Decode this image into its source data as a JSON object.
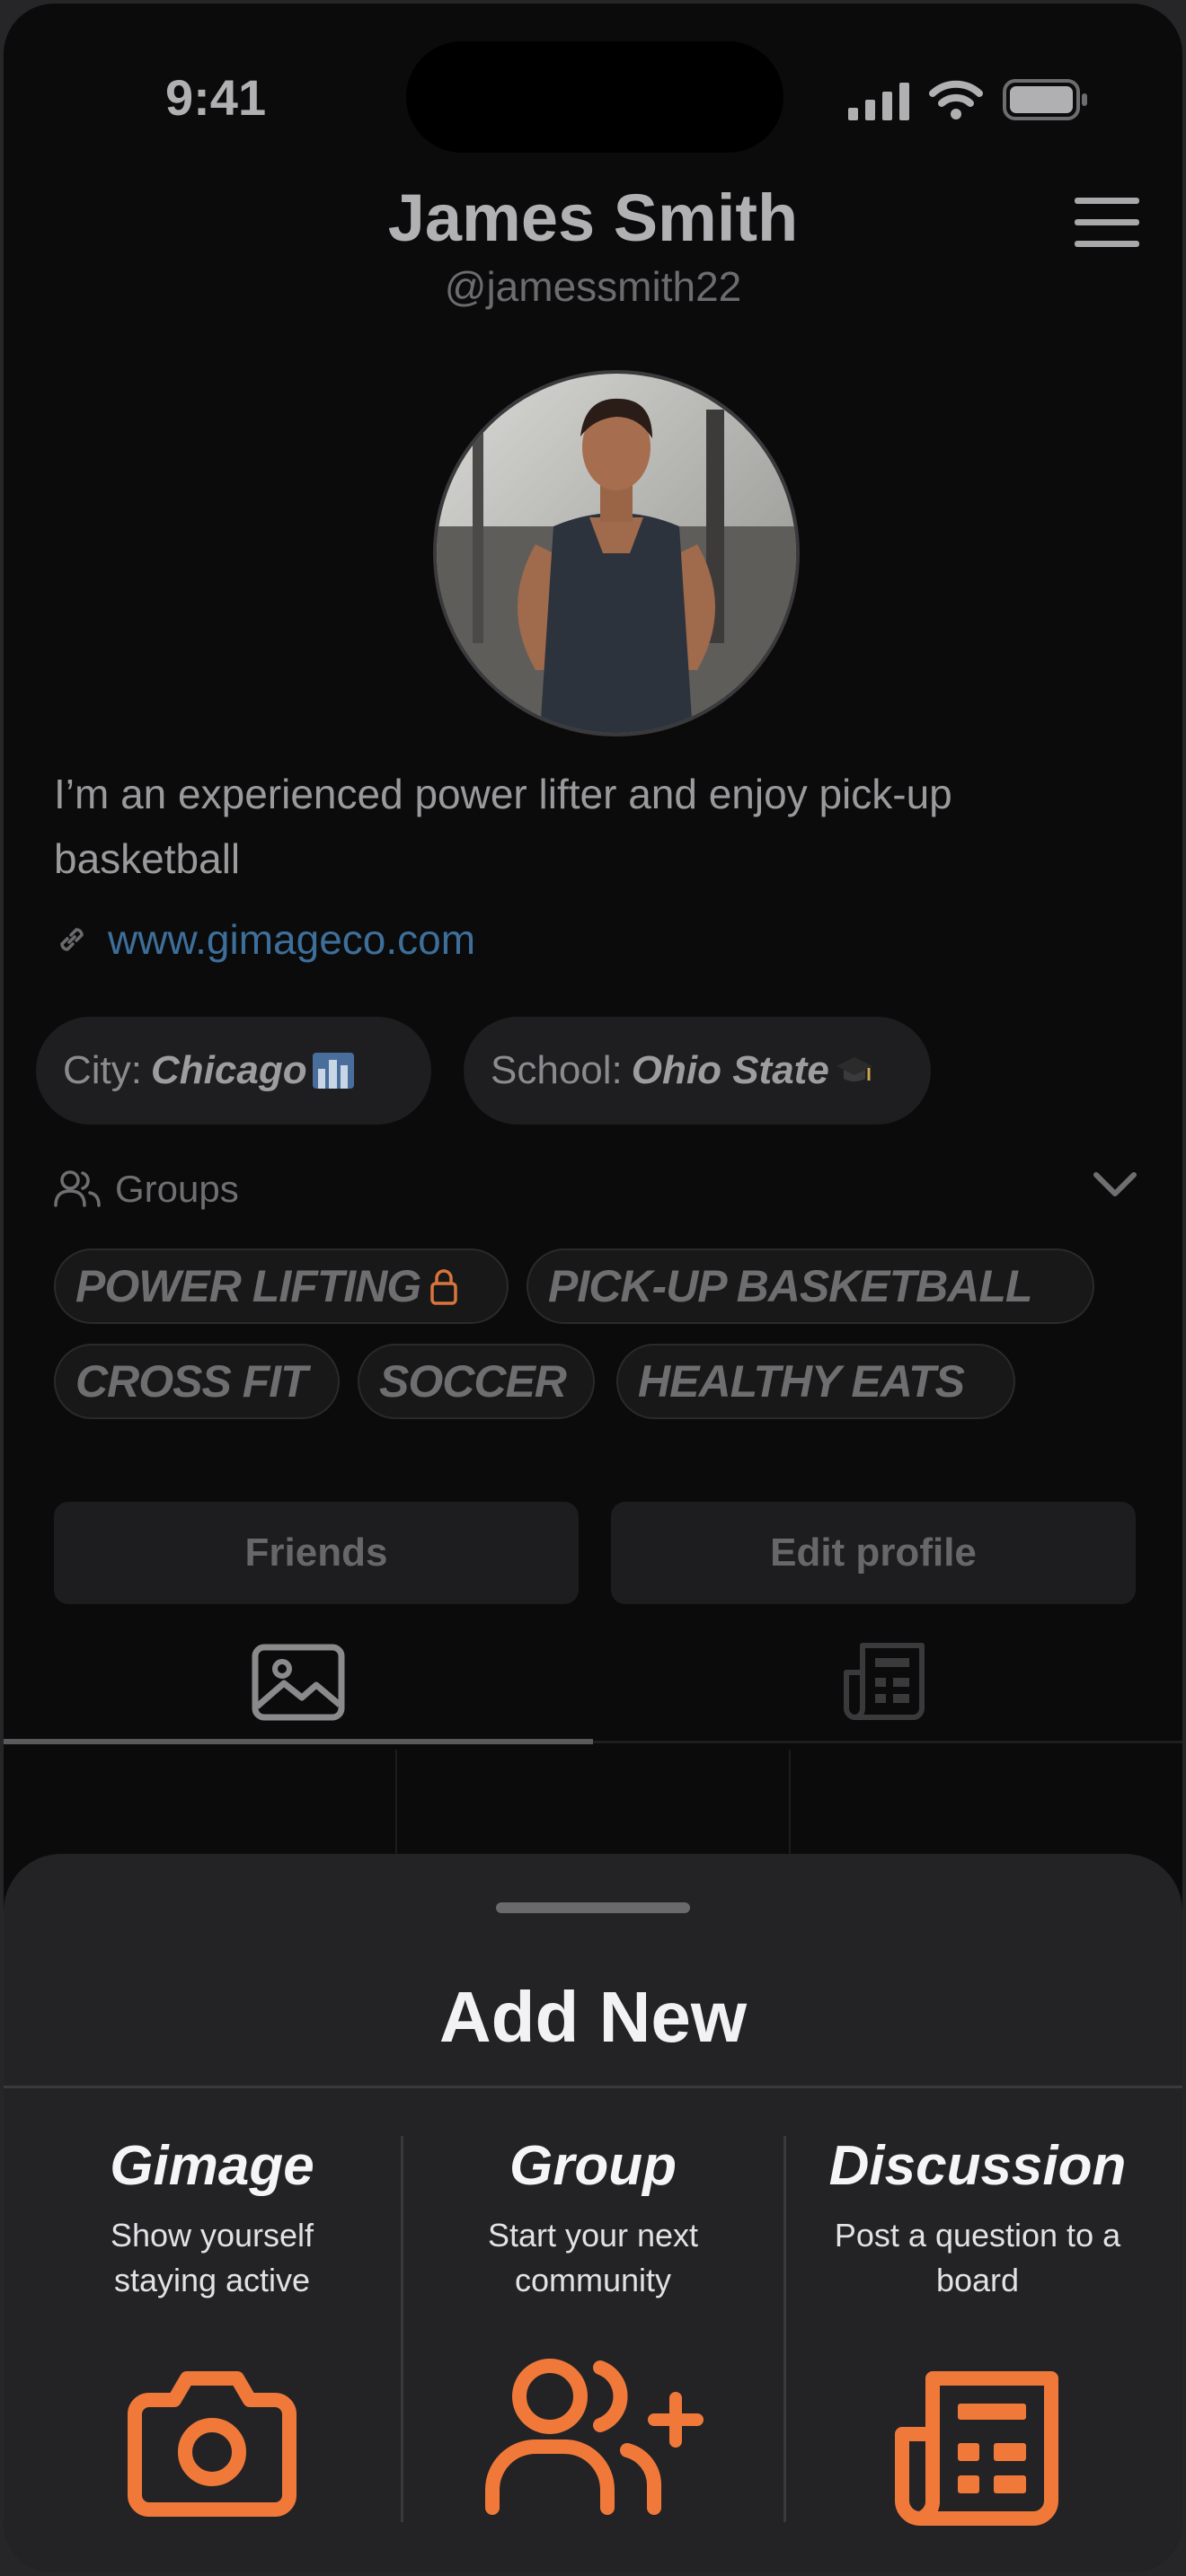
{
  "status_bar": {
    "time": "9:41"
  },
  "profile": {
    "name": "James Smith",
    "handle": "@jamessmith22",
    "bio": "I’m an experienced power lifter and enjoy pick-up basketball",
    "website": "www.gimageco.com",
    "city_label": "City:",
    "city_value": "Chicago",
    "school_label": "School:",
    "school_value": "Ohio State"
  },
  "groups": {
    "label": "Groups",
    "tags": [
      "POWER LIFTING",
      "PICK-UP BASKETBALL",
      "CROSS FIT",
      "SOCCER",
      "HEALTHY EATS"
    ]
  },
  "buttons": {
    "friends": "Friends",
    "edit_profile": "Edit profile"
  },
  "sheet": {
    "title": "Add New",
    "options": [
      {
        "title": "Gimage",
        "subtitle_line1": "Show yourself",
        "subtitle_line2": "staying active",
        "icon": "camera-icon"
      },
      {
        "title": "Group",
        "subtitle_line1": "Start your next",
        "subtitle_line2": "community",
        "icon": "add-users-icon"
      },
      {
        "title": "Discussion",
        "subtitle_line1": "Post a question to a",
        "subtitle_line2": "board",
        "icon": "newspaper-icon"
      }
    ]
  },
  "colors": {
    "accent": "#f0793a",
    "link": "#3d6f9a",
    "background": "#0b0b0c",
    "sheet": "#232326"
  }
}
